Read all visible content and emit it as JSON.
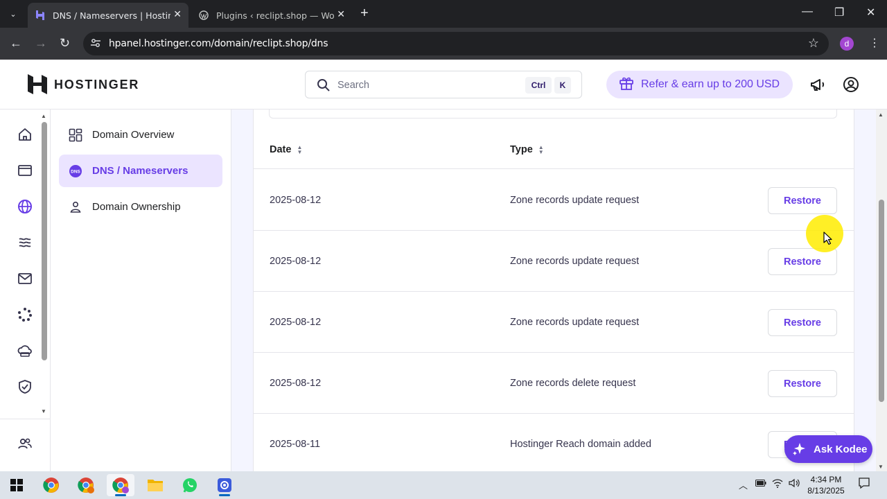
{
  "browser": {
    "tabs": [
      {
        "title": "DNS / Nameservers | Hostinger",
        "active": true
      },
      {
        "title": "Plugins ‹ reclipt.shop — WordPress",
        "active": false
      }
    ],
    "url": "hpanel.hostinger.com/domain/reclipt.shop/dns",
    "profile_initial": "d"
  },
  "header": {
    "brand": "HOSTINGER",
    "search_placeholder": "Search",
    "kbd_ctrl": "Ctrl",
    "kbd_k": "K",
    "refer_label": "Refer & earn up to 200 USD"
  },
  "rail": {
    "icons": [
      "home-icon",
      "websites-icon",
      "domains-icon",
      "hosting-icon",
      "email-icon",
      "marketplace-icon",
      "cloud-icon",
      "security-icon",
      "team-icon"
    ]
  },
  "submenu": {
    "items": [
      {
        "label": "Domain Overview",
        "active": false
      },
      {
        "label": "DNS / Nameservers",
        "active": true
      },
      {
        "label": "Domain Ownership",
        "active": false
      }
    ]
  },
  "table": {
    "columns": [
      "Date",
      "Type"
    ],
    "restore_label": "Restore",
    "rows": [
      {
        "date": "2025-08-12",
        "type": "Zone records update request"
      },
      {
        "date": "2025-08-12",
        "type": "Zone records update request"
      },
      {
        "date": "2025-08-12",
        "type": "Zone records update request"
      },
      {
        "date": "2025-08-12",
        "type": "Zone records delete request"
      },
      {
        "date": "2025-08-11",
        "type": "Hostinger Reach domain added"
      }
    ]
  },
  "ask_kodee": "Ask Kodee",
  "taskbar": {
    "time": "4:34 PM",
    "date": "8/13/2025"
  },
  "colors": {
    "accent": "#673de6",
    "accent_light": "#ebe4ff",
    "page_bg": "#f4f5ff"
  }
}
